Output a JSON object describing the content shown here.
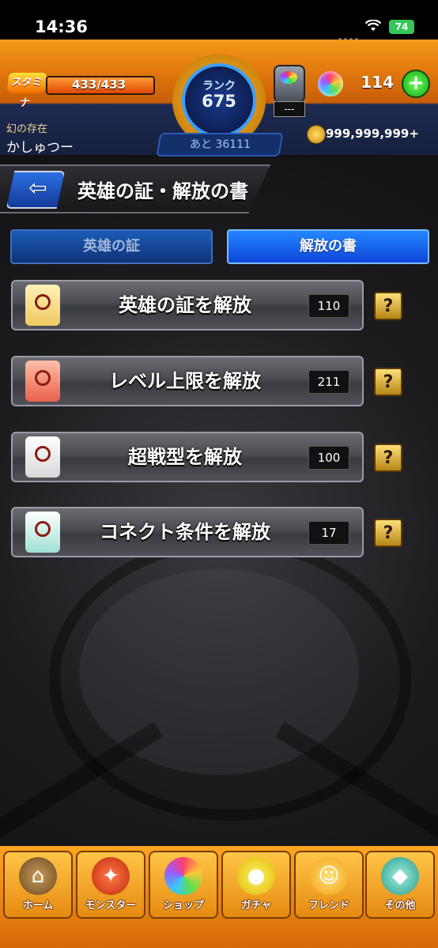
{
  "status_bar": {
    "time": "14:36",
    "battery": "74"
  },
  "header": {
    "stamina_label": "スタミナ",
    "stamina_value": "433/433",
    "rank_label": "ランク",
    "rank_value": "675",
    "next_rank": "あと 36111",
    "item_count": "---",
    "orb_count": "114",
    "plus_label": "+",
    "player_title": "幻の存在",
    "player_name": "かしゅつー",
    "coins": "999,999,999+"
  },
  "page": {
    "back_arrow": "⇦",
    "title": "英雄の証・解放の書"
  },
  "tabs": [
    {
      "label": "英雄の証",
      "active": false
    },
    {
      "label": "解放の書",
      "active": true
    }
  ],
  "menu": [
    {
      "label": "英雄の証を解放",
      "count": "110",
      "icon": "scroll-red-seal-icon"
    },
    {
      "label": "レベル上限を解放",
      "count": "211",
      "icon": "scroll-red-crest-icon"
    },
    {
      "label": "超戦型を解放",
      "count": "100",
      "icon": "scroll-white-crest-icon"
    },
    {
      "label": "コネクト条件を解放",
      "count": "17",
      "icon": "scroll-teal-connect-icon"
    }
  ],
  "help_label": "?",
  "bottom_nav": [
    {
      "label": "ホーム",
      "icon": "home-icon"
    },
    {
      "label": "モンスター",
      "icon": "monster-icon"
    },
    {
      "label": "ショップ",
      "icon": "shop-orb-icon"
    },
    {
      "label": "ガチャ",
      "icon": "gacha-egg-icon"
    },
    {
      "label": "フレンド",
      "icon": "friend-icon"
    },
    {
      "label": "その他",
      "icon": "other-icon"
    }
  ],
  "colors": {
    "accent_orange": "#e2780e",
    "tab_active": "#2387ff",
    "menu_plate": "#4b4c52",
    "help_gold": "#b78516"
  }
}
